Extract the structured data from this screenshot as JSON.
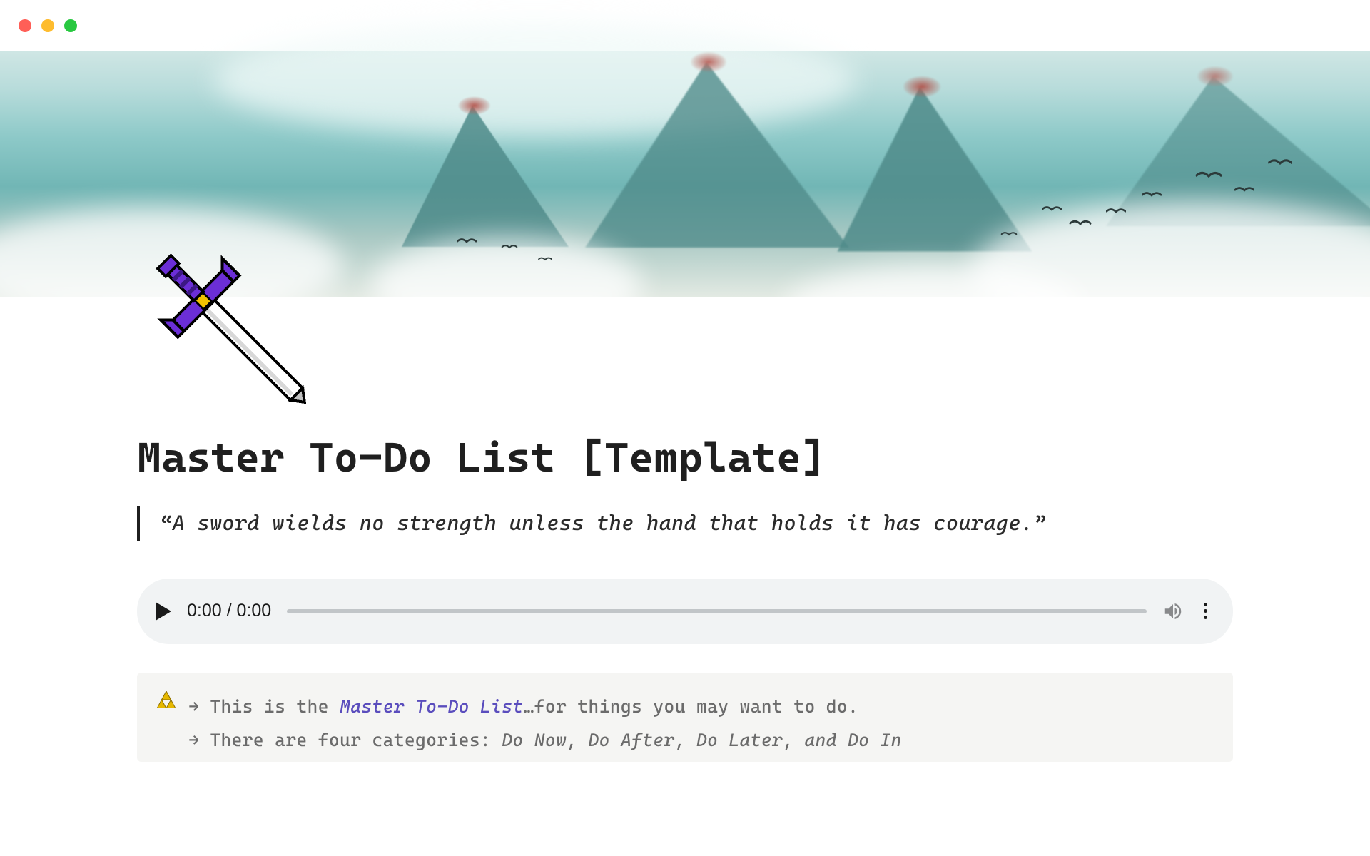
{
  "titlebar": {
    "dots": [
      "red",
      "yellow",
      "green"
    ]
  },
  "icon_name": "pixel-sword-icon",
  "title": "Master To-Do List [Template]",
  "quote": "“A sword wields no strength unless the hand that holds it has courage.”",
  "audio": {
    "current": "0:00",
    "separator": " / ",
    "duration": "0:00"
  },
  "callout": {
    "badge": "▲",
    "arrow": "→",
    "line1_a": "This is the ",
    "line1_em": "Master To-Do List",
    "line1_b": "…for things you may want to do.",
    "line2_a": "There are four categories: ",
    "line2_em": "Do Now, Do After, Do Later, and Do In"
  }
}
